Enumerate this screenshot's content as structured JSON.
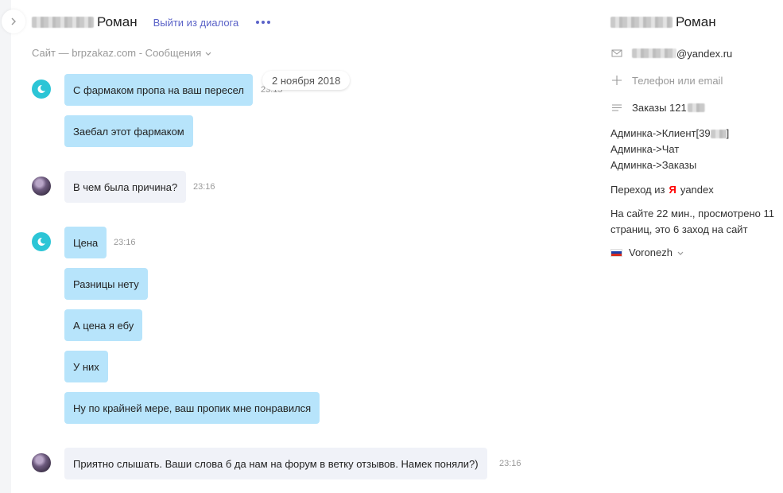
{
  "chat": {
    "contact_name": "Роман",
    "leave_label": "Выйти из диалога",
    "source_label": "Сайт — brpzakaz.com - Сообщения",
    "date_label": "2 ноября 2018",
    "messages": [
      {
        "text": "С фармаком пропа на ваш пересел",
        "time": "23:15",
        "from": "operator"
      },
      {
        "text": "Заебал этот фармаком",
        "from": "operator"
      },
      {
        "text": "В чем была причина?",
        "time": "23:16",
        "from": "user"
      },
      {
        "text": "Цена",
        "time": "23:16",
        "from": "operator"
      },
      {
        "text": "Разницы нету",
        "from": "operator"
      },
      {
        "text": "А цена я ебу",
        "from": "operator"
      },
      {
        "text": "У них",
        "from": "operator"
      },
      {
        "text": "Ну по крайней мере, ваш пропик мне понравился",
        "from": "operator"
      },
      {
        "text": "Приятно слышать. Ваши слова б да нам на форум в ветку отзывов. Намек поняли?)",
        "time": "23:16",
        "from": "user"
      }
    ]
  },
  "sidebar": {
    "contact_name": "Роман",
    "email_suffix": "@yandex.ru",
    "phone_placeholder": "Телефон или email",
    "orders_label": "Заказы 121",
    "links": [
      "Админка->Клиент[39",
      "Админка->Чат",
      "Админка->Заказы"
    ],
    "client_link_close": "]",
    "referrer_prefix": "Переход из",
    "referrer_logo": "Я",
    "referrer_name": "yandex",
    "visit_info": "На сайте 22 мин., просмотрено 11 страниц, это 6 заход на сайт",
    "city": "Voronezh"
  },
  "colors": {
    "accent": "#5b63c8",
    "operator_bubble": "#b7e4fb",
    "user_bubble": "#f0f2f8",
    "bot_avatar": "#2cc5d6",
    "yandex_red": "#ff0000"
  }
}
